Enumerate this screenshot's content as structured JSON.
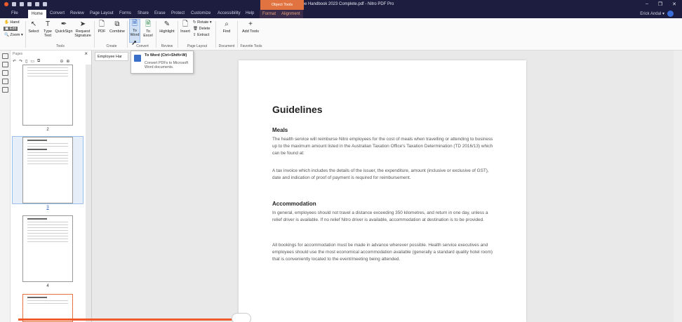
{
  "window": {
    "title": "Employee Handbook 2023 Complete.pdf - Nitro PDF Pro",
    "contextual_group": "Object Tools",
    "controls": [
      "–",
      "❐",
      "✕"
    ]
  },
  "menu": {
    "tabs": [
      "File",
      "Home",
      "Convert",
      "Review",
      "Page Layout",
      "Forms",
      "Share",
      "Erase",
      "Protect",
      "Customize",
      "Accessibility",
      "Help",
      "Format",
      "Alignment"
    ],
    "user": "Erick Andal ▾"
  },
  "ribbon": {
    "view": {
      "hand": "Hand",
      "edit": "Edit",
      "zoom": "Zoom ▾"
    },
    "tools": {
      "select": "Select",
      "type_text": "Type Text",
      "quicksign": "QuickSign",
      "request_signature": "Request Signature",
      "group": "Tools"
    },
    "create": {
      "pdf": "PDF",
      "combine": "Combine",
      "group": "Create"
    },
    "convert": {
      "to_word": "To Word",
      "to_excel": "To Excel",
      "group": "Convert"
    },
    "review": {
      "highlight": "Highlight",
      "group": "Review"
    },
    "page_layout": {
      "insert": "Insert",
      "rotate": "Rotate ▾",
      "delete": "Delete",
      "extract": "Extract",
      "group": "Page Layout"
    },
    "document": {
      "find": "Find",
      "group": "Document"
    },
    "favorite": {
      "add_tools": "Add Tools",
      "group": "Favorite Tools"
    }
  },
  "tooltip": {
    "title": "To Word (Ctrl+Shift+W)",
    "description": "Convert PDFs to Microsoft Word documents."
  },
  "sidebar": {
    "header": "Pages",
    "page_numbers": [
      "2",
      "3",
      "4"
    ]
  },
  "document_tab": {
    "label": "Employee Har"
  },
  "page": {
    "heading": "Guidelines",
    "section1": {
      "title": "Meals",
      "p1": "The health service will reimburse Nitro employees for the cost of meals when travelling or attending to business up to the maximum amount listed in the Australian Taxation Office's Taxation Determination (TD 2016/13) which can be found at:",
      "p2": "A tax invoice which includes the details of the issuer, the expenditure, amount (inclusive or exclusive of GST), date and indication of proof of payment is required for reimbursement."
    },
    "section2": {
      "title": "Accommodation",
      "p1": "In general, employees should not travel a distance exceeding 350 kilometres, and return in one day, unless a relief driver is available. If no relief Nitro driver is available, accommodation at destination is to be provided.",
      "p2": "All bookings for accommodation must be made in advance wherever possible. Health service executives and employees should use the most economical accommodation available (generally a standard quality hotel room) that is conveniently located to the event/meeting being attended."
    }
  }
}
